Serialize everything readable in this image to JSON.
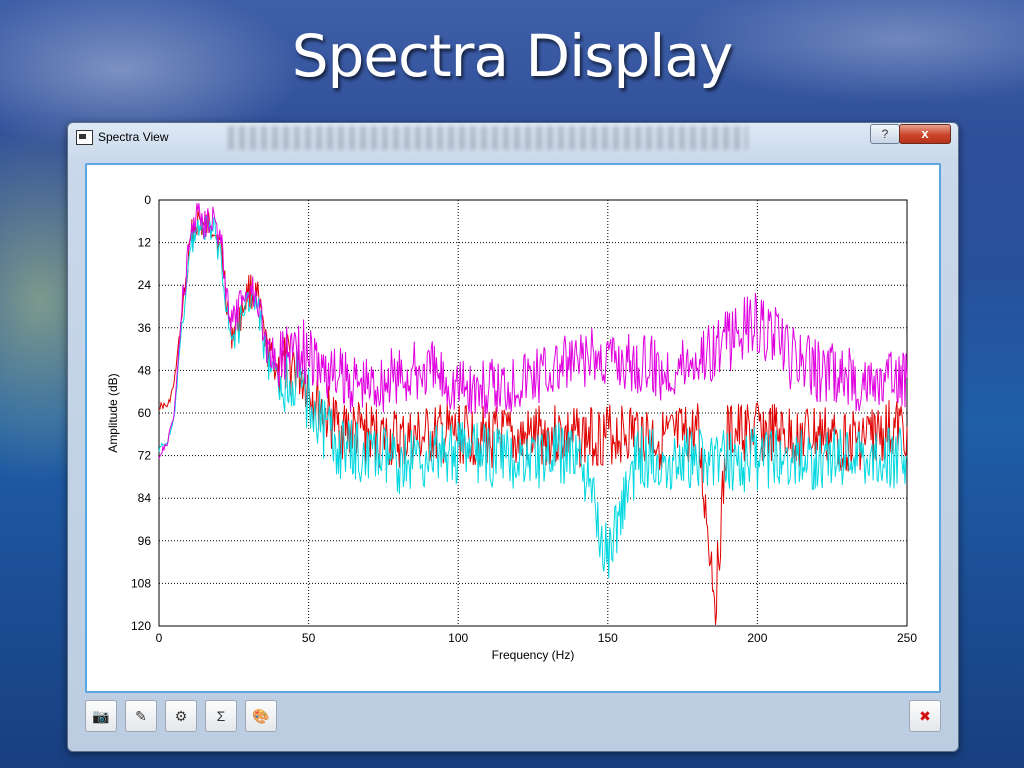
{
  "slide": {
    "title": "Spectra Display"
  },
  "window": {
    "title": "Spectra View",
    "help_label": "?",
    "close_label": "x"
  },
  "toolbar": {
    "buttons": [
      {
        "name": "camera-icon",
        "glyph": "📷"
      },
      {
        "name": "edit-icon",
        "glyph": "✎"
      },
      {
        "name": "chart-settings-icon",
        "glyph": "⚙"
      },
      {
        "name": "sigma-icon",
        "glyph": "Σ"
      },
      {
        "name": "palette-icon",
        "glyph": "🎨"
      }
    ],
    "close_glyph": "✖"
  },
  "colors": {
    "series_red": "#e00000",
    "series_cyan": "#00d8e0",
    "series_magenta": "#e000e0",
    "accent": "#5aa6e0"
  },
  "chart_data": {
    "type": "line",
    "xlabel": "Frequency (Hz)",
    "ylabel": "Amplitude (dB)",
    "xlim": [
      0,
      250
    ],
    "ylim": [
      0,
      120
    ],
    "y_inverted": true,
    "grid": true,
    "x_ticks": [
      "0",
      "50",
      "100",
      "150",
      "200",
      "250"
    ],
    "y_ticks": [
      "0",
      "12",
      "24",
      "36",
      "48",
      "60",
      "72",
      "84",
      "96",
      "108",
      "120"
    ],
    "series": [
      {
        "color": "#e00000",
        "x": [
          0,
          3,
          5,
          8,
          11,
          13,
          15,
          18,
          21,
          24,
          27,
          30,
          33,
          36,
          40,
          45,
          50,
          55,
          60,
          70,
          80,
          90,
          100,
          110,
          120,
          130,
          140,
          150,
          160,
          170,
          180,
          186,
          190,
          200,
          210,
          220,
          230,
          240,
          250
        ],
        "y": [
          58,
          58,
          52,
          30,
          10,
          5,
          8,
          6,
          15,
          38,
          33,
          25,
          28,
          42,
          48,
          46,
          52,
          60,
          64,
          66,
          68,
          67,
          66,
          67,
          68,
          66,
          67,
          66,
          65,
          68,
          66,
          112,
          66,
          65,
          67,
          66,
          68,
          66,
          64
        ]
      },
      {
        "color": "#00d8e0",
        "x": [
          0,
          3,
          5,
          8,
          11,
          13,
          15,
          18,
          21,
          24,
          27,
          30,
          33,
          36,
          40,
          45,
          50,
          55,
          60,
          70,
          80,
          90,
          100,
          110,
          120,
          130,
          140,
          150,
          160,
          170,
          180,
          190,
          200,
          210,
          220,
          230,
          240,
          250
        ],
        "y": [
          70,
          68,
          62,
          32,
          12,
          6,
          9,
          8,
          17,
          40,
          35,
          27,
          30,
          45,
          52,
          50,
          56,
          64,
          70,
          72,
          74,
          72,
          71,
          72,
          73,
          72,
          71,
          100,
          72,
          73,
          72,
          74,
          73,
          72,
          74,
          72,
          73,
          72
        ]
      },
      {
        "color": "#e000e0",
        "x": [
          0,
          3,
          5,
          8,
          11,
          13,
          15,
          18,
          21,
          24,
          27,
          30,
          33,
          36,
          40,
          45,
          50,
          55,
          60,
          70,
          80,
          90,
          100,
          110,
          120,
          130,
          140,
          150,
          160,
          170,
          180,
          190,
          198,
          205,
          210,
          220,
          230,
          240,
          250
        ],
        "y": [
          72,
          68,
          60,
          28,
          8,
          2,
          6,
          4,
          14,
          36,
          30,
          24,
          27,
          42,
          45,
          40,
          44,
          48,
          50,
          52,
          50,
          48,
          52,
          54,
          50,
          48,
          46,
          44,
          46,
          48,
          44,
          40,
          34,
          38,
          44,
          48,
          50,
          52,
          50
        ]
      }
    ]
  }
}
